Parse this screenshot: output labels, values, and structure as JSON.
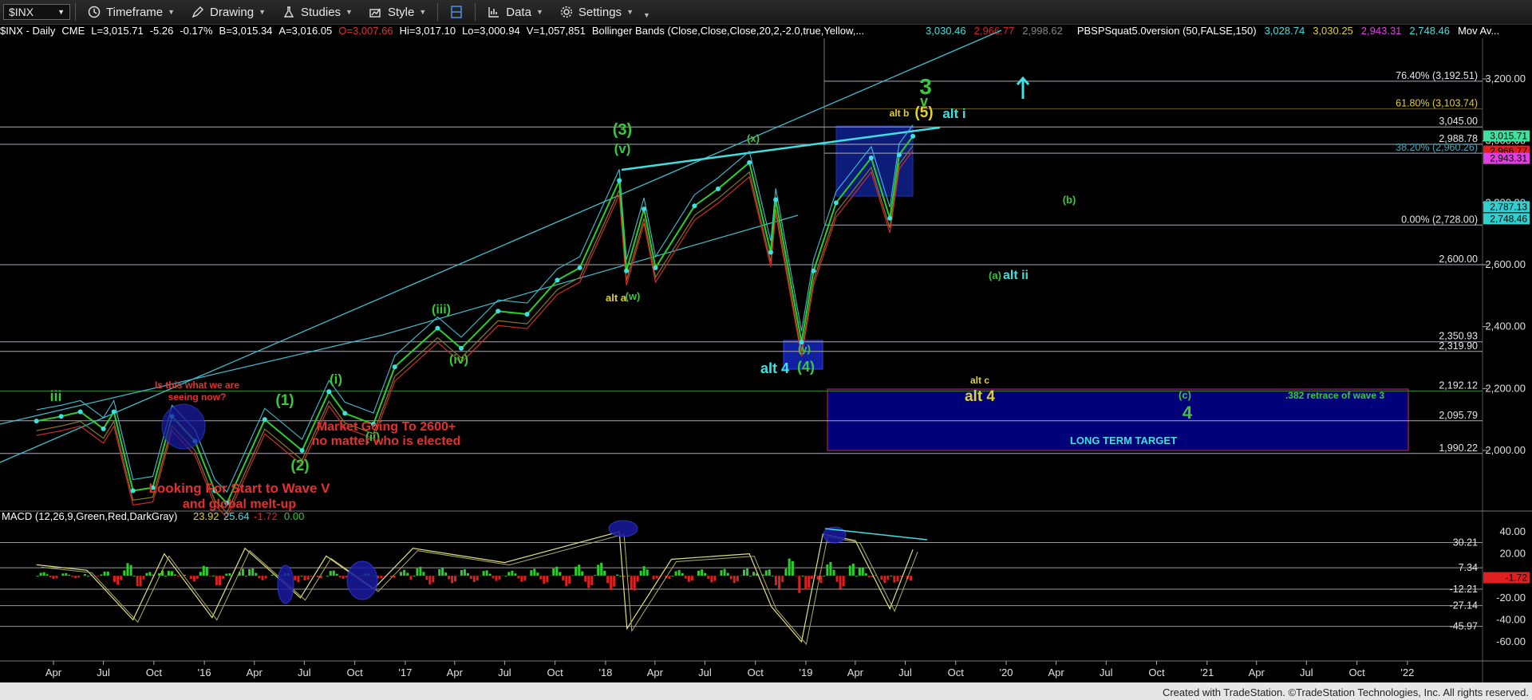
{
  "toolbar": {
    "symbol": "$INX",
    "items": [
      "Timeframe",
      "Drawing",
      "Studies",
      "Style",
      "Data",
      "Settings"
    ]
  },
  "header": {
    "symbol_period": "$INX - Daily",
    "exchange": "CME",
    "last": "L=3,015.71",
    "change": "-5.26",
    "change_pct": "-0.17%",
    "bid": "B=3,015.34",
    "ask": "A=3,016.05",
    "open": "O=3,007.66",
    "high": "Hi=3,017.10",
    "low": "Lo=3,000.94",
    "volume": "V=1,057,851",
    "bb_study": "Bollinger Bands (Close,Close,Close,20,2,-2.0,true,Yellow,...",
    "bb_v1": "3,030.46",
    "bb_v2": "2,966.77",
    "bb_v3": "2,998.62",
    "pbs_study": "PBSPSquat5.0version (50,FALSE,150)",
    "pbs_v1": "3,028.74",
    "pbs_v2": "3,030.25",
    "pbs_v3": "2,943.31",
    "pbs_v4": "2,748.46",
    "mov": "Mov Av..."
  },
  "colors": {
    "background": "#000000",
    "price_cyan": "#3fe0e0",
    "wave_green": "#39c83a",
    "annotation_red": "#e53030",
    "fib_gold": "#b9a533",
    "target_box": "#00007a",
    "macd_green": "#2ad02a",
    "macd_red": "#e02020"
  },
  "chart_data": [
    {
      "type": "line",
      "title": "$INX - Daily",
      "x_ticks": [
        "Apr",
        "Jul",
        "Oct",
        "'16",
        "Apr",
        "Jul",
        "Oct",
        "'17",
        "Apr",
        "Jul",
        "Oct",
        "'18",
        "Apr",
        "Jul",
        "Oct",
        "'19",
        "Apr",
        "Jul",
        "Oct",
        "'20",
        "Apr",
        "Jul",
        "Oct",
        "'21",
        "Apr",
        "Jul",
        "Oct",
        "'22"
      ],
      "y_ticks": [
        2000,
        2200,
        2400,
        2600,
        2800,
        3000,
        3200
      ],
      "y_tick_labels": [
        "2,000.00",
        "2,200.00",
        "2,400.00",
        "2,600.00",
        "2,800.00",
        "3,000.00",
        "3,200.00"
      ],
      "ylim": [
        1890,
        3350
      ],
      "series": [
        {
          "x": [
            "2015-03-01",
            "2015-04-15",
            "2015-05-20",
            "2015-07-01",
            "2015-07-20",
            "2015-08-24",
            "2015-09-29",
            "2015-11-03",
            "2015-12-15",
            "2016-01-20",
            "2016-02-11",
            "2016-04-20",
            "2016-06-27",
            "2016-08-15",
            "2016-09-13",
            "2016-11-04",
            "2016-12-13",
            "2017-03-01",
            "2017-04-13",
            "2017-06-19",
            "2017-08-11",
            "2017-10-05",
            "2017-11-15",
            "2018-01-26",
            "2018-02-08",
            "2018-03-12",
            "2018-04-02",
            "2018-06-12",
            "2018-07-25",
            "2018-09-20",
            "2018-10-29",
            "2018-11-07",
            "2018-12-24",
            "2019-01-15",
            "2019-02-25",
            "2019-04-30",
            "2019-06-03",
            "2019-06-20",
            "2019-07-15"
          ],
          "values": [
            2095,
            2110,
            2125,
            2070,
            2125,
            1870,
            1880,
            2110,
            2030,
            1870,
            1830,
            2100,
            2000,
            2190,
            2120,
            2085,
            2270,
            2395,
            2330,
            2450,
            2440,
            2550,
            2590,
            2872,
            2580,
            2780,
            2590,
            2790,
            2845,
            2930,
            2640,
            2810,
            2350,
            2580,
            2800,
            2945,
            2750,
            2955,
            3015
          ]
        },
        {
          "name": "MACD (12,26,9,Green,Red,DarkGray)",
          "axis": "lower",
          "x": [
            "2015-03-01",
            "2015-06-01",
            "2015-08-24",
            "2015-10-20",
            "2016-01-15",
            "2016-03-15",
            "2016-06-24",
            "2016-08-10",
            "2016-11-04",
            "2017-01-15",
            "2017-07-01",
            "2018-01-26",
            "2018-02-09",
            "2018-05-01",
            "2018-09-20",
            "2018-10-30",
            "2018-12-24",
            "2019-02-01",
            "2019-04-01",
            "2019-06-03",
            "2019-07-15"
          ],
          "values": [
            10,
            5,
            -40,
            20,
            -38,
            25,
            -20,
            18,
            -12,
            25,
            12,
            40,
            -48,
            15,
            20,
            -28,
            -60,
            38,
            32,
            -30,
            23.92
          ]
        }
      ],
      "horizontal_levels": [
        {
          "label": "76.40% (3,192.51)",
          "value": 3192.51
        },
        {
          "label": "61.80% (3,103.74)",
          "value": 3103.74
        },
        {
          "label": "3,045.00",
          "value": 3045
        },
        {
          "label": "2,988.78",
          "value": 2988.78
        },
        {
          "label": "38.20% (2,960.26)",
          "value": 2960.26
        },
        {
          "label": "0.00% (2,728.00)",
          "value": 2728
        },
        {
          "label": "2,600.00",
          "value": 2600
        },
        {
          "label": "2,350.93",
          "value": 2350.93
        },
        {
          "label": "2,319.90",
          "value": 2319.9
        },
        {
          "label": "2,192.12",
          "value": 2192.12
        },
        {
          "label": "2,095.79",
          "value": 2095.79
        },
        {
          "label": "1,990.22",
          "value": 1990.22
        }
      ],
      "price_flags": [
        {
          "label": "3,015.71",
          "value": 3015.71,
          "color": "#3fe0a0"
        },
        {
          "label": "2,966.77",
          "value": 2966.77,
          "color": "#e02020"
        },
        {
          "label": "2,943.31",
          "value": 2943.31,
          "color": "#e040e0"
        },
        {
          "label": "2,787.13",
          "value": 2787.13,
          "color": "#30d0d0"
        },
        {
          "label": "2,748.46",
          "value": 2748.46,
          "color": "#30d0d0"
        }
      ],
      "annotations": [
        {
          "text": "3",
          "color": "#39c83a"
        },
        {
          "text": "v",
          "color": "#39c83a"
        },
        {
          "text": "(5)",
          "color": "#e0d030"
        },
        {
          "text": "alt b",
          "color": "#e0d030"
        },
        {
          "text": "alt i",
          "color": "#3fe0e0"
        },
        {
          "text": "(3)",
          "color": "#39c83a"
        },
        {
          "text": "(v)",
          "color": "#39c83a"
        },
        {
          "text": "(x)",
          "color": "#39c83a"
        },
        {
          "text": "(b)",
          "color": "#39c83a"
        },
        {
          "text": "(a)",
          "color": "#39c83a"
        },
        {
          "text": "alt ii",
          "color": "#3fe0e0"
        },
        {
          "text": "alt a",
          "color": "#e0d030"
        },
        {
          "text": "(w)",
          "color": "#39c83a"
        },
        {
          "text": "(iii)",
          "color": "#39c83a"
        },
        {
          "text": "(iv)",
          "color": "#39c83a"
        },
        {
          "text": "(y)",
          "color": "#39c83a"
        },
        {
          "text": "(4)",
          "color": "#39c83a"
        },
        {
          "text": "alt 4",
          "color": "#3fe0e0"
        },
        {
          "text": "alt c",
          "color": "#e0d030"
        },
        {
          "text": "alt 4",
          "color": "#e0d030"
        },
        {
          "text": "(c)",
          "color": "#39c83a"
        },
        {
          "text": "4",
          "color": "#39c83a"
        },
        {
          "text": ".382 retrace of wave 3",
          "color": "#39c83a"
        },
        {
          "text": "LONG TERM TARGET",
          "color": "#3fe0e0"
        },
        {
          "text": "iii",
          "color": "#39c83a"
        },
        {
          "text": "Is this what we are",
          "color": "#e53030"
        },
        {
          "text": "seeing now?",
          "color": "#e53030"
        },
        {
          "text": "(1)",
          "color": "#39c83a"
        },
        {
          "text": "(i)",
          "color": "#39c83a"
        },
        {
          "text": "(ii)",
          "color": "#39c83a"
        },
        {
          "text": "(2)",
          "color": "#39c83a"
        },
        {
          "text": "Market Going To 2600+",
          "color": "#e53030"
        },
        {
          "text": "no matter who is elected",
          "color": "#e53030"
        },
        {
          "text": "Looking For Start to Wave V",
          "color": "#e53030"
        },
        {
          "text": "and global melt-up",
          "color": "#e53030"
        }
      ]
    },
    {
      "type": "line",
      "title": "MACD (12,26,9,Green,Red,DarkGray)",
      "legend_values": [
        "23.92",
        "25.64",
        "-1.72",
        "0.00"
      ],
      "y_ticks": [
        -60,
        -40,
        -20,
        0,
        20,
        40
      ],
      "y_tick_labels": [
        "-60.00",
        "-40.00",
        "-20.00",
        "",
        "20.00",
        "40.00"
      ],
      "ylim": [
        -68,
        48
      ],
      "levels": [
        {
          "label": "30.21",
          "value": 30.21
        },
        {
          "label": "7.34",
          "value": 7.34
        },
        {
          "label": "-12.21",
          "value": -12.21
        },
        {
          "label": "-27.14",
          "value": -27.14
        },
        {
          "label": "-45.97",
          "value": -45.97
        }
      ],
      "flag": {
        "label": "-1.72",
        "value": -1.72
      }
    }
  ],
  "footer": "Created with TradeStation. ©TradeStation Technologies, Inc. All rights reserved."
}
